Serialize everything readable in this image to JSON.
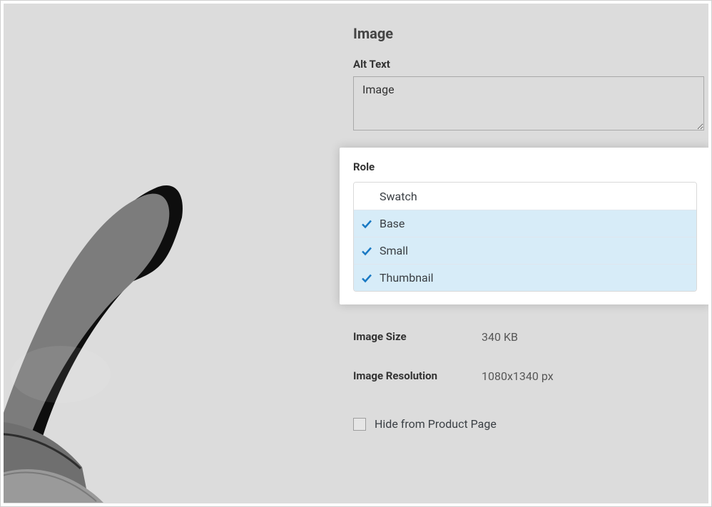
{
  "panel": {
    "title": "Image",
    "alt_text_label": "Alt Text",
    "alt_text_value": "Image",
    "role": {
      "label": "Role",
      "options": [
        {
          "label": "Swatch",
          "selected": false
        },
        {
          "label": "Base",
          "selected": true
        },
        {
          "label": "Small",
          "selected": true
        },
        {
          "label": "Thumbnail",
          "selected": true
        }
      ]
    },
    "image_size": {
      "label": "Image Size",
      "value": "340 KB"
    },
    "image_resolution": {
      "label": "Image Resolution",
      "value": "1080x1340 px"
    },
    "hide_checkbox": {
      "label": "Hide from Product Page",
      "checked": false
    }
  }
}
